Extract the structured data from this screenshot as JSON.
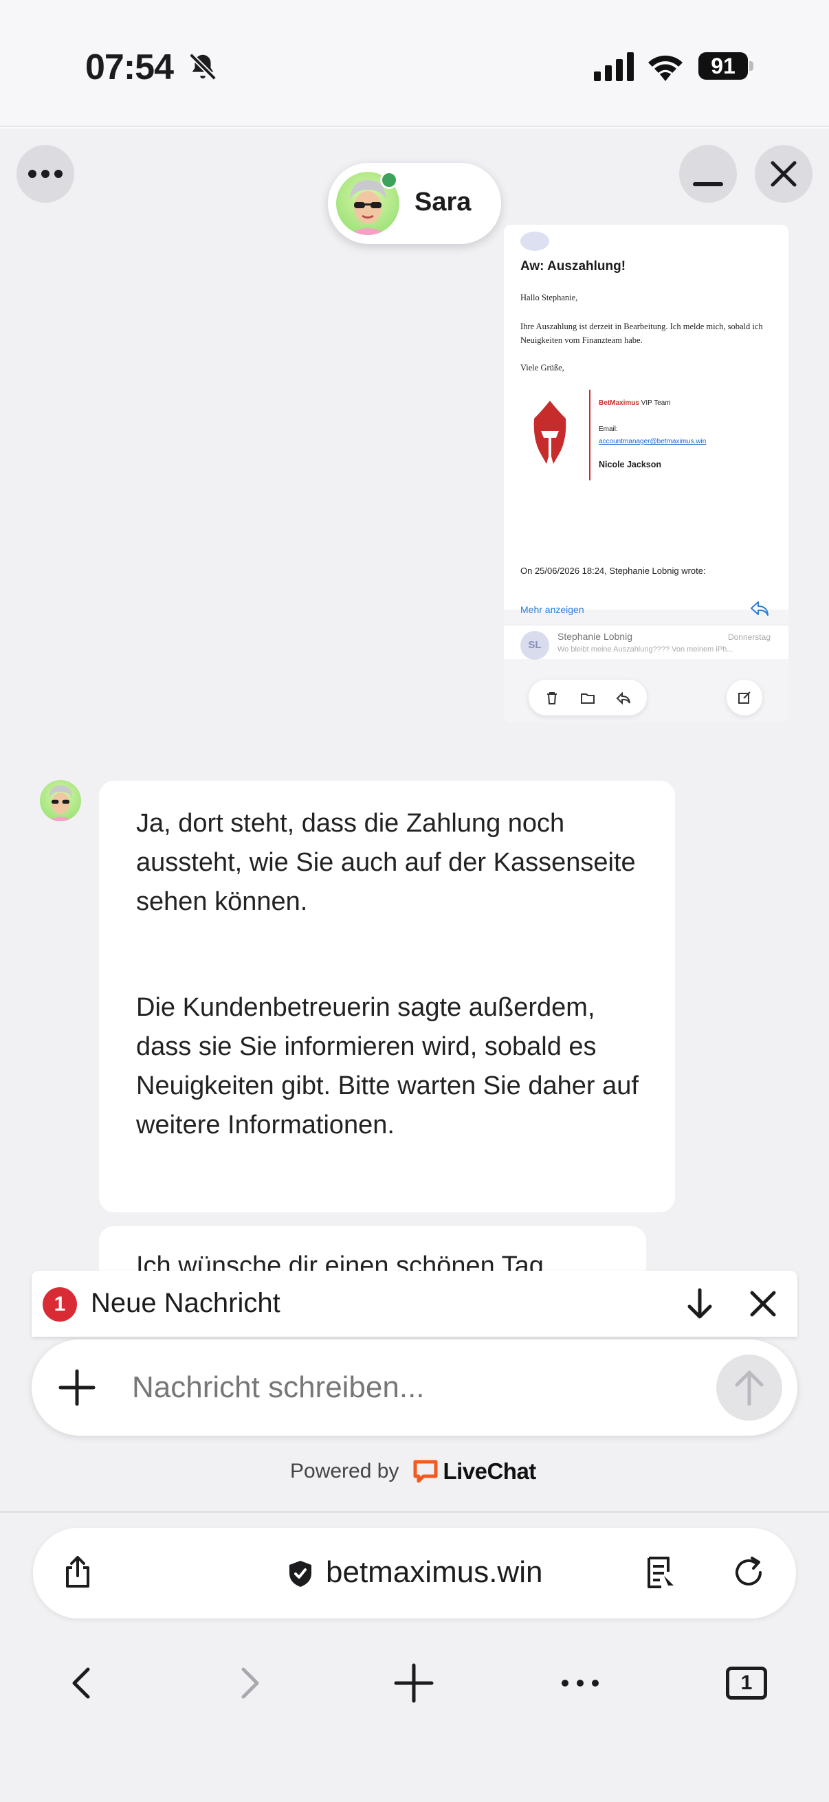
{
  "status_bar": {
    "time": "07:54",
    "battery": "91",
    "icons": [
      "bell-slash-icon",
      "cellular-signal-icon",
      "wifi-icon",
      "battery-icon"
    ]
  },
  "chat_header": {
    "agent_name": "Sara",
    "agent_status": "online",
    "buttons": [
      "more-icon",
      "minimize-icon",
      "close-icon"
    ]
  },
  "attachment": {
    "subject": "Aw: Auszahlung!",
    "greeting": "Hallo Stephanie,",
    "body": "Ihre Auszahlung ist derzeit in Bearbeitung. Ich melde mich, sobald ich Neuigkeiten vom Finanzteam habe.",
    "closing": "Viele Grüße,",
    "sig_brand": "BetMaximus",
    "sig_team": " VIP Team",
    "sig_email_label": "Email:",
    "sig_email": "accountmanager@betmaximus.win",
    "sig_name": "Nicole Jackson",
    "quote_line": "On 25/06/2026 18:24, Stephanie Lobnig wrote:",
    "more_link": "Mehr anzeigen",
    "thread_initials": "SL",
    "thread_sender": "Stephanie Lobnig",
    "thread_date": "Donnerstag",
    "thread_preview": "Wo bleibt meine Auszahlung???? Von meinem iPh..."
  },
  "messages": [
    {
      "text": "Ja, dort steht, dass die Zahlung noch aussteht, wie Sie auch auf der Kassenseite sehen können."
    },
    {
      "text": "Die Kundenbetreuerin sagte außerdem, dass sie Sie informieren wird, sobald es Neuigkeiten gibt. Bitte warten Sie daher auf weitere Informationen."
    },
    {
      "text": "Ich wünsche dir einen schönen Tag"
    }
  ],
  "new_message_bar": {
    "count": "1",
    "label": "Neue Nachricht"
  },
  "composer": {
    "placeholder": "Nachricht schreiben..."
  },
  "powered_by": {
    "text": "Powered by",
    "brand": "LiveChat",
    "brand_color": "#f25a22"
  },
  "browser": {
    "url": "betmaximus.win",
    "tab_count": "1",
    "icons": [
      "share-icon",
      "shield-icon",
      "reader-mode-icon",
      "reload-icon",
      "back-icon",
      "forward-icon",
      "new-tab-icon",
      "menu-icon",
      "tabs-icon"
    ]
  }
}
